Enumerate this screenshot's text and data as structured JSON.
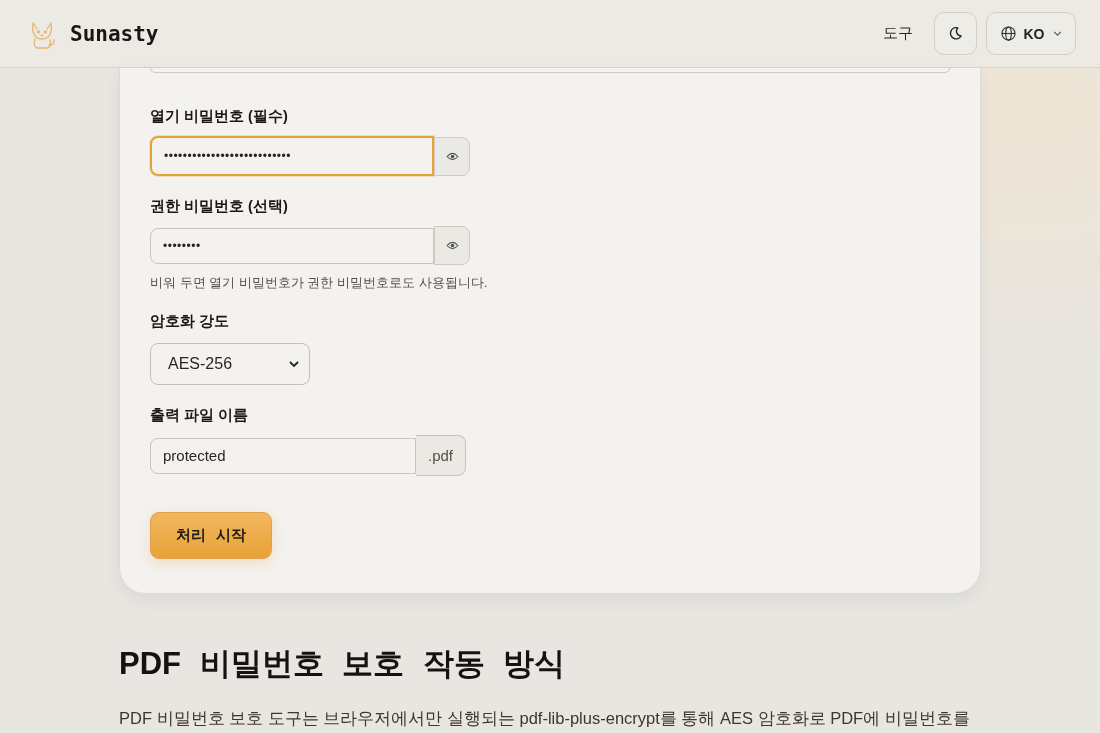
{
  "header": {
    "logo_text": "Sunasty",
    "nav_link": "도구",
    "language": "KO"
  },
  "form": {
    "fields": [
      {
        "kind": "password",
        "label": "열기 비밀번호 (필수)",
        "value": "•••••••••••••••••••••••••••",
        "focused": true
      },
      {
        "kind": "password",
        "label": "권한 비밀번호 (선택)",
        "value": "••••••••",
        "focused": false,
        "hint": "비워 두면 열기 비밀번호가 권한 비밀번호로도 사용됩니다."
      },
      {
        "kind": "select",
        "label": "암호화 강도",
        "value": "AES-256",
        "focused": false
      },
      {
        "kind": "filename",
        "label": "출력 파일 이름",
        "value": "protected",
        "suffix": ".pdf",
        "focused": false
      }
    ],
    "submit_button": "처리 시작"
  },
  "section": {
    "heading": "PDF 비밀번호 보호 작동 방식",
    "paragraph": "PDF 비밀번호 보호 도구는 브라우저에서만 실행되는 pdf-lib-plus-encrypt를 통해 AES 암호화로 PDF에 비밀번호를"
  }
}
